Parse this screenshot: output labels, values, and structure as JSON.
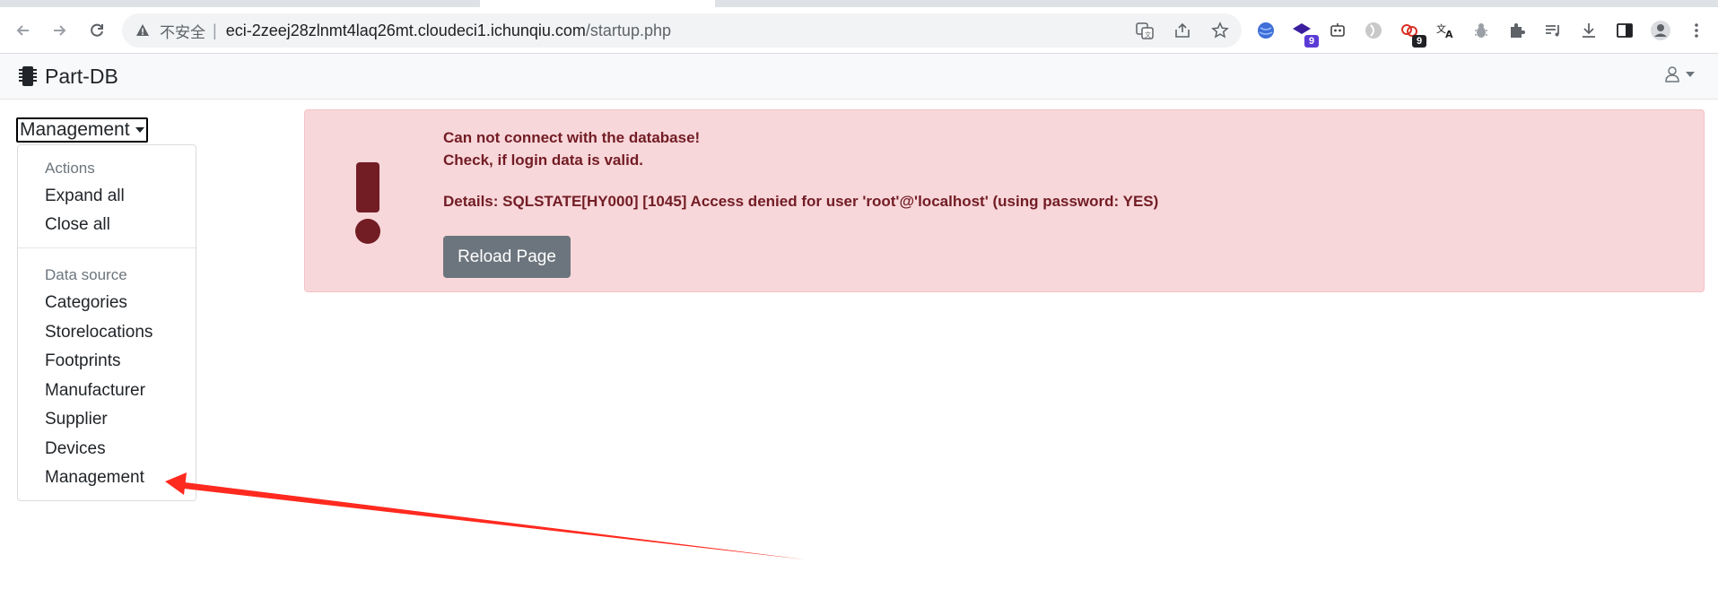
{
  "browser": {
    "address": {
      "security_label": "不安全",
      "host": "eci-2zeej28zlnmt4laq26mt.cloudeci1.ichunqiu.com",
      "path": "/startup.php"
    },
    "extensions": [
      {
        "icon": "globe-extension-icon"
      },
      {
        "icon": "graduation-extension-icon",
        "badge": "9",
        "badge_color": "#5b3bd6"
      },
      {
        "icon": "robot-extension-icon"
      },
      {
        "icon": "circle-extension-icon"
      },
      {
        "icon": "link-extension-icon",
        "badge": "9",
        "badge_color": "#202124"
      },
      {
        "icon": "translate-extension-icon"
      },
      {
        "icon": "bug-extension-icon"
      },
      {
        "icon": "puzzle-extension-icon"
      },
      {
        "icon": "media-control-icon"
      },
      {
        "icon": "download-icon"
      },
      {
        "icon": "sidepanel-icon"
      },
      {
        "icon": "profile-icon"
      },
      {
        "icon": "kebab-menu-icon"
      }
    ]
  },
  "navbar": {
    "brand": "Part-DB"
  },
  "sidebar": {
    "toggle_label": "Management",
    "menu": {
      "actions_header": "Actions",
      "actions": [
        "Expand all",
        "Close all"
      ],
      "datasource_header": "Data source",
      "sources": [
        "Categories",
        "Storelocations",
        "Footprints",
        "Manufacturer",
        "Supplier",
        "Devices",
        "Management"
      ]
    }
  },
  "alert": {
    "line1": "Can not connect with the database!",
    "line2": "Check, if login data is valid.",
    "details": "Details: SQLSTATE[HY000] [1045] Access denied for user 'root'@'localhost' (using password: YES)",
    "button": "Reload Page"
  },
  "colors": {
    "alert_bg": "#f8d7da",
    "alert_text": "#721c24",
    "annotation_arrow": "#ff2a1f",
    "button_bg": "#6c757d"
  }
}
